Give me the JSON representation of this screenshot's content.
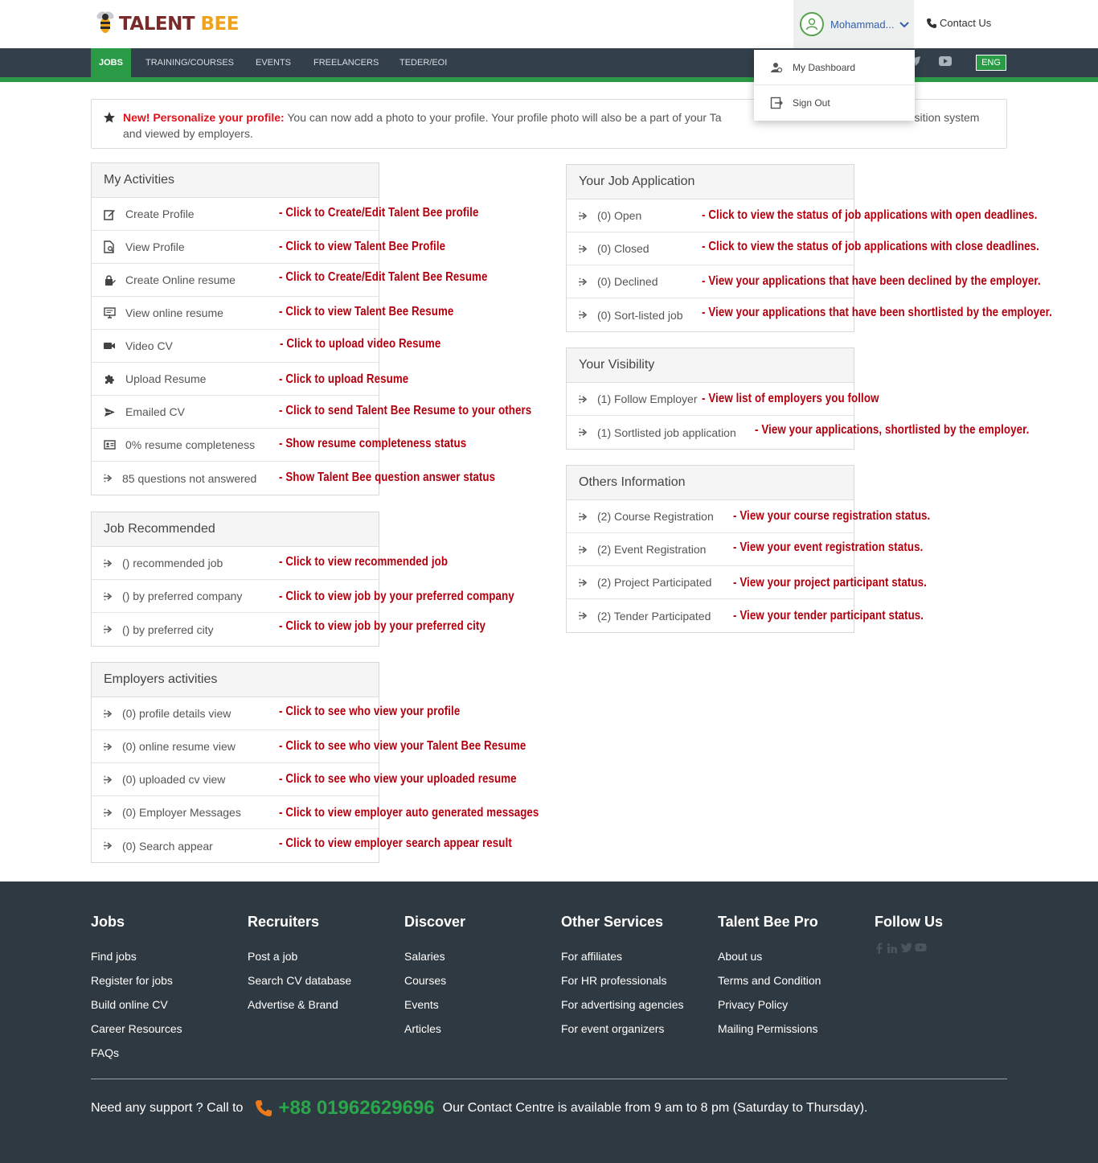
{
  "header": {
    "logo_part1": "TALENT",
    "logo_part2": "BEE",
    "user_name": "Mohammad...",
    "contact_label": "Contact Us",
    "lang": "ENG"
  },
  "nav": [
    "JOBS",
    "TRAINING/COURSES",
    "EVENTS",
    "FREELANCERS",
    "TEDER/EOI"
  ],
  "dropdown": {
    "dashboard": "My Dashboard",
    "signout": "Sign Out"
  },
  "notice": {
    "bold": "New! Personalize your profile:",
    "text_a": " You can now add a photo to your profile. Your profile photo will also be a part of your Ta",
    "text_b": "sition system and viewed by employers."
  },
  "my_activities": {
    "title": "My Activities",
    "items": [
      {
        "label": "Create Profile",
        "note": "- Click to Create/Edit Talent Bee profile"
      },
      {
        "label": "View Profile",
        "note": "- Click to view Talent Bee Profile"
      },
      {
        "label": "Create Online resume",
        "note": "- Click to Create/Edit Talent Bee Resume"
      },
      {
        "label": "View online resume",
        "note": "- Click to view Talent Bee Resume"
      },
      {
        "label": "Video CV",
        "note": "- Click to upload video Resume"
      },
      {
        "label": "Upload Resume",
        "note": "- Click to upload Resume"
      },
      {
        "label": "Emailed CV",
        "note": "- Click to send Talent Bee Resume to your others"
      },
      {
        "label": "0% resume completeness",
        "note": "- Show resume completeness status"
      },
      {
        "label": "85 questions not answered",
        "note": "- Show Talent Bee question answer status"
      }
    ]
  },
  "job_recommended": {
    "title": "Job Recommended",
    "items": [
      {
        "label": "() recommended job",
        "note": "- Click to view recommended job"
      },
      {
        "label": "() by preferred company",
        "note": "- Click to view job by your preferred company"
      },
      {
        "label": "() by preferred city",
        "note": "- Click to view job by your preferred city"
      }
    ]
  },
  "employers_activities": {
    "title": "Employers activities",
    "items": [
      {
        "label": "(0) profile details view",
        "note": "- Click to see who view your profile"
      },
      {
        "label": "(0) online resume view",
        "note": "- Click to see who view your Talent Bee Resume"
      },
      {
        "label": "(0) uploaded cv view",
        "note": "- Click to see who view your uploaded resume"
      },
      {
        "label": "(0) Employer Messages",
        "note": "- Click to view employer auto generated messages"
      },
      {
        "label": "(0) Search appear",
        "note": "- Click to view employer search appear result"
      }
    ]
  },
  "job_application": {
    "title": "Your Job Application",
    "items": [
      {
        "label": "(0) Open",
        "note": "- Click to view the status of job applications with open deadlines."
      },
      {
        "label": "(0) Closed",
        "note": "- Click to view the status of job applications with close deadlines."
      },
      {
        "label": "(0) Declined",
        "note": "- View your applications that have been declined by the employer."
      },
      {
        "label": "(0) Sort-listed job",
        "note": "- View your applications that have been shortlisted by the employer."
      }
    ]
  },
  "visibility": {
    "title": "Your Visibility",
    "items": [
      {
        "label": "(1) Follow Employer",
        "note": "- View list of employers you follow"
      },
      {
        "label": "(1) Sortlisted job application",
        "note": "- View your applications, shortlisted by the employer."
      }
    ]
  },
  "others_info": {
    "title": "Others Information",
    "items": [
      {
        "label": "(2) Course Registration",
        "note": "- View your course registration status."
      },
      {
        "label": "(2) Event Registration",
        "note": "- View your event registration status."
      },
      {
        "label": "(2) Project Participated",
        "note": "- View your project participant status."
      },
      {
        "label": "(2) Tender Participated",
        "note": "- View your tender participant status."
      }
    ]
  },
  "footer": {
    "columns": [
      {
        "title": "Jobs",
        "links": [
          "Find jobs",
          "Register for jobs",
          "Build online CV",
          "Career Resources",
          "FAQs"
        ]
      },
      {
        "title": "Recruiters",
        "links": [
          "Post a job",
          "Search CV database",
          "Advertise & Brand"
        ]
      },
      {
        "title": "Discover",
        "links": [
          "Salaries",
          "Courses",
          "Events",
          "Articles"
        ]
      },
      {
        "title": "Other Services",
        "links": [
          "For affiliates",
          "For HR professionals",
          "For advertising agencies",
          "For event organizers"
        ]
      },
      {
        "title": "Talent Bee Pro",
        "links": [
          "About us",
          "Terms and Condition",
          "Privacy Policy",
          "Mailing Permissions"
        ]
      },
      {
        "title": "Follow Us",
        "links": []
      }
    ],
    "support_prefix": "Need any support ? Call to",
    "phone": "+88 01962629696",
    "support_suffix": "Our Contact Centre is available from 9 am to 8 pm (Saturday to Thursday)."
  },
  "colors": {
    "brand_green": "#2b9a47",
    "nav_dark": "#333f4a",
    "annotation_red": "#b3000f",
    "footer_bg": "#2f3941"
  }
}
